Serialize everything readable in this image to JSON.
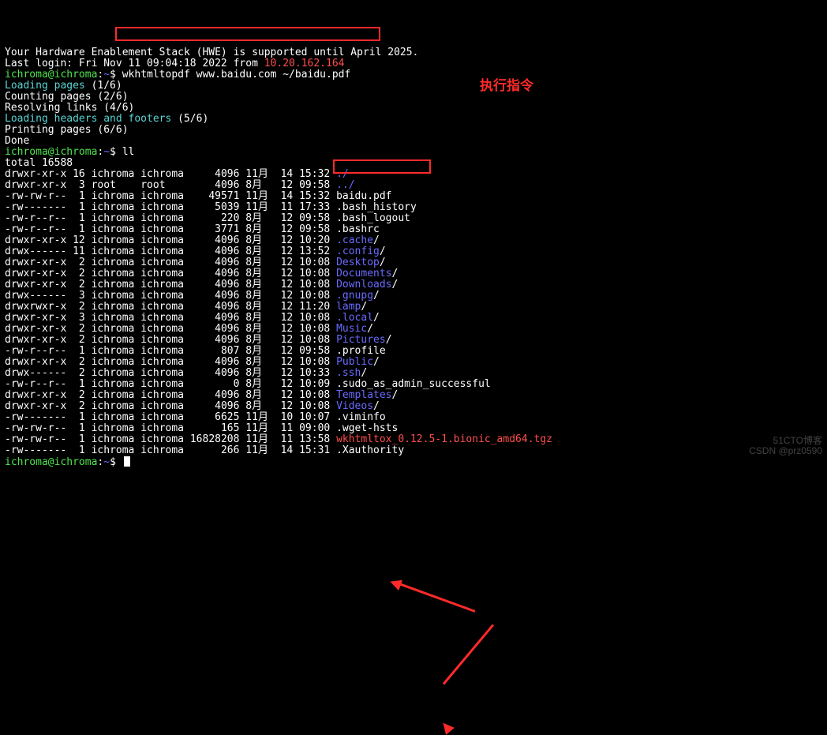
{
  "header": [
    {
      "type": "plain",
      "text": "Your Hardware Enablement Stack (HWE) is supported until April 2025."
    },
    {
      "type": "lastlogin",
      "prefix": "Last login: Fri Nov 11 09:04:18 2022 from ",
      "ip": "10.20.162.164"
    }
  ],
  "prompt": {
    "user": "ichroma@ichroma",
    "sep": ":",
    "path": "~",
    "sym": "$"
  },
  "command1": "wkhtmltopdf www.baidu.com ~/baidu.pdf",
  "progress": [
    {
      "label": "Loading pages",
      "count": "(1/6)",
      "highlight": true
    },
    {
      "label": "Counting pages",
      "count": "(2/6)"
    },
    {
      "label": "Resolving links",
      "count": "(4/6)"
    },
    {
      "label": "Loading headers and footers",
      "count": "(5/6)",
      "highlight": true
    },
    {
      "label": "Printing pages",
      "count": "(6/6)"
    }
  ],
  "done": "Done",
  "command2": "ll",
  "total": "total 16588",
  "rows": [
    {
      "perm": "drwxr-xr-x",
      "n": "16",
      "own": "ichroma",
      "grp": "ichroma",
      "size": "4096",
      "mon": "11月",
      "day": "14",
      "time": "15:32",
      "name": "./",
      "kind": "dir"
    },
    {
      "perm": "drwxr-xr-x",
      "n": "3",
      "own": "root",
      "grp": "root",
      "size": "4096",
      "mon": "8月",
      "day": "12",
      "time": "09:58",
      "name": "../",
      "kind": "dir"
    },
    {
      "perm": "-rw-rw-r--",
      "n": "1",
      "own": "ichroma",
      "grp": "ichroma",
      "size": "49571",
      "mon": "11月",
      "day": "14",
      "time": "15:32",
      "name": "baidu.pdf",
      "kind": "file"
    },
    {
      "perm": "-rw-------",
      "n": "1",
      "own": "ichroma",
      "grp": "ichroma",
      "size": "5039",
      "mon": "11月",
      "day": "11",
      "time": "17:33",
      "name": ".bash_history",
      "kind": "file"
    },
    {
      "perm": "-rw-r--r--",
      "n": "1",
      "own": "ichroma",
      "grp": "ichroma",
      "size": "220",
      "mon": "8月",
      "day": "12",
      "time": "09:58",
      "name": ".bash_logout",
      "kind": "file"
    },
    {
      "perm": "-rw-r--r--",
      "n": "1",
      "own": "ichroma",
      "grp": "ichroma",
      "size": "3771",
      "mon": "8月",
      "day": "12",
      "time": "09:58",
      "name": ".bashrc",
      "kind": "file"
    },
    {
      "perm": "drwxr-xr-x",
      "n": "12",
      "own": "ichroma",
      "grp": "ichroma",
      "size": "4096",
      "mon": "8月",
      "day": "12",
      "time": "10:20",
      "name": ".cache",
      "slash": "/",
      "kind": "dir"
    },
    {
      "perm": "drwx------",
      "n": "11",
      "own": "ichroma",
      "grp": "ichroma",
      "size": "4096",
      "mon": "8月",
      "day": "12",
      "time": "13:52",
      "name": ".config",
      "slash": "/",
      "kind": "dir"
    },
    {
      "perm": "drwxr-xr-x",
      "n": "2",
      "own": "ichroma",
      "grp": "ichroma",
      "size": "4096",
      "mon": "8月",
      "day": "12",
      "time": "10:08",
      "name": "Desktop",
      "slash": "/",
      "kind": "dir"
    },
    {
      "perm": "drwxr-xr-x",
      "n": "2",
      "own": "ichroma",
      "grp": "ichroma",
      "size": "4096",
      "mon": "8月",
      "day": "12",
      "time": "10:08",
      "name": "Documents",
      "slash": "/",
      "kind": "dir"
    },
    {
      "perm": "drwxr-xr-x",
      "n": "2",
      "own": "ichroma",
      "grp": "ichroma",
      "size": "4096",
      "mon": "8月",
      "day": "12",
      "time": "10:08",
      "name": "Downloads",
      "slash": "/",
      "kind": "dir"
    },
    {
      "perm": "drwx------",
      "n": "3",
      "own": "ichroma",
      "grp": "ichroma",
      "size": "4096",
      "mon": "8月",
      "day": "12",
      "time": "10:08",
      "name": ".gnupg",
      "slash": "/",
      "kind": "dir"
    },
    {
      "perm": "drwxrwxr-x",
      "n": "2",
      "own": "ichroma",
      "grp": "ichroma",
      "size": "4096",
      "mon": "8月",
      "day": "12",
      "time": "11:20",
      "name": "lamp",
      "slash": "/",
      "kind": "dir"
    },
    {
      "perm": "drwxr-xr-x",
      "n": "3",
      "own": "ichroma",
      "grp": "ichroma",
      "size": "4096",
      "mon": "8月",
      "day": "12",
      "time": "10:08",
      "name": ".local",
      "slash": "/",
      "kind": "dir"
    },
    {
      "perm": "drwxr-xr-x",
      "n": "2",
      "own": "ichroma",
      "grp": "ichroma",
      "size": "4096",
      "mon": "8月",
      "day": "12",
      "time": "10:08",
      "name": "Music",
      "slash": "/",
      "kind": "dir"
    },
    {
      "perm": "drwxr-xr-x",
      "n": "2",
      "own": "ichroma",
      "grp": "ichroma",
      "size": "4096",
      "mon": "8月",
      "day": "12",
      "time": "10:08",
      "name": "Pictures",
      "slash": "/",
      "kind": "dir"
    },
    {
      "perm": "-rw-r--r--",
      "n": "1",
      "own": "ichroma",
      "grp": "ichroma",
      "size": "807",
      "mon": "8月",
      "day": "12",
      "time": "09:58",
      "name": ".profile",
      "kind": "file"
    },
    {
      "perm": "drwxr-xr-x",
      "n": "2",
      "own": "ichroma",
      "grp": "ichroma",
      "size": "4096",
      "mon": "8月",
      "day": "12",
      "time": "10:08",
      "name": "Public",
      "slash": "/",
      "kind": "dir"
    },
    {
      "perm": "drwx------",
      "n": "2",
      "own": "ichroma",
      "grp": "ichroma",
      "size": "4096",
      "mon": "8月",
      "day": "12",
      "time": "10:33",
      "name": ".ssh",
      "slash": "/",
      "kind": "dir"
    },
    {
      "perm": "-rw-r--r--",
      "n": "1",
      "own": "ichroma",
      "grp": "ichroma",
      "size": "0",
      "mon": "8月",
      "day": "12",
      "time": "10:09",
      "name": ".sudo_as_admin_successful",
      "kind": "file"
    },
    {
      "perm": "drwxr-xr-x",
      "n": "2",
      "own": "ichroma",
      "grp": "ichroma",
      "size": "4096",
      "mon": "8月",
      "day": "12",
      "time": "10:08",
      "name": "Templates",
      "slash": "/",
      "kind": "dir"
    },
    {
      "perm": "drwxr-xr-x",
      "n": "2",
      "own": "ichroma",
      "grp": "ichroma",
      "size": "4096",
      "mon": "8月",
      "day": "12",
      "time": "10:08",
      "name": "Videos",
      "slash": "/",
      "kind": "dir"
    },
    {
      "perm": "-rw-------",
      "n": "1",
      "own": "ichroma",
      "grp": "ichroma",
      "size": "6625",
      "mon": "11月",
      "day": "10",
      "time": "10:07",
      "name": ".viminfo",
      "kind": "file"
    },
    {
      "perm": "-rw-rw-r--",
      "n": "1",
      "own": "ichroma",
      "grp": "ichroma",
      "size": "165",
      "mon": "11月",
      "day": "11",
      "time": "09:00",
      "name": ".wget-hsts",
      "kind": "file"
    },
    {
      "perm": "-rw-rw-r--",
      "n": "1",
      "own": "ichroma",
      "grp": "ichroma",
      "size": "16828208",
      "mon": "11月",
      "day": "11",
      "time": "13:58",
      "name": "wkhtmltox_0.12.5-1.bionic_amd64.tgz",
      "kind": "archive"
    },
    {
      "perm": "-rw-------",
      "n": "1",
      "own": "ichroma",
      "grp": "ichroma",
      "size": "266",
      "mon": "11月",
      "day": "14",
      "time": "15:31",
      "name": ".Xauthority",
      "kind": "file"
    }
  ],
  "annotation": "执行指令",
  "watermark": {
    "l1": "51CTO博客",
    "l2": "CSDN @prz0590"
  }
}
